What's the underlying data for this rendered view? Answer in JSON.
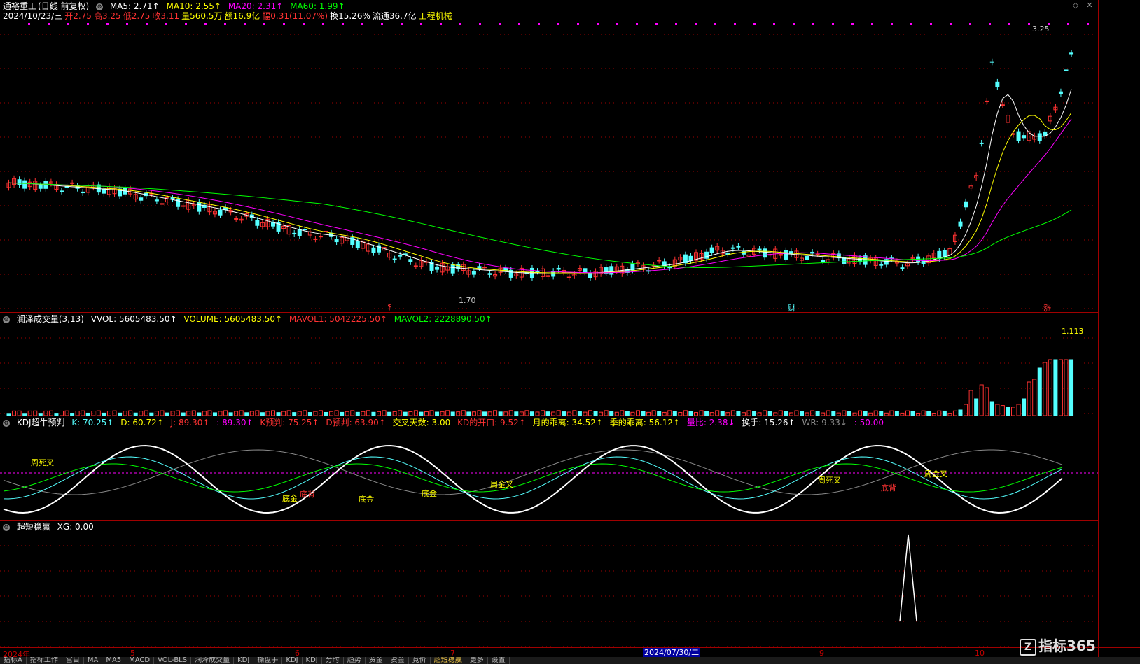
{
  "price_panel": {
    "stock_name": "通裕重工",
    "mode": "(日线 前复权)",
    "ma5": "MA5: 2.71↑",
    "ma10": "MA10: 2.55↑",
    "ma20": "MA20: 2.31↑",
    "ma60": "MA60: 1.99↑",
    "date": "2024/10/23/三",
    "open": "开2.75",
    "high": "高3.25",
    "low": "低2.75",
    "close": "收3.11",
    "volume": "量560.5万",
    "amount": "额16.9亿",
    "change": "幅0.31(11.07%)",
    "turnover": "换15.26%",
    "float": "流通36.7亿",
    "industry": "工程机械",
    "high_label": "3.25",
    "low_label": "1.70",
    "markers": [
      "$",
      "财",
      "涨"
    ]
  },
  "volume_panel": {
    "title": "润泽成交量(3,13)",
    "vvol": "VVOL: 5605483.50↑",
    "volume": "VOLUME: 5605483.50↑",
    "mavol1": "MAVOL1: 5042225.50↑",
    "mavol2": "MAVOL2: 2228890.50↑",
    "scale_label": "1.113"
  },
  "kdj_panel": {
    "title": "KDJ超牛预判",
    "k": "K: 70.25↑",
    "d": "D: 60.72↑",
    "j": "J: 89.30↑",
    "j2": ": 89.30↑",
    "k_pred": "K预判: 75.25↑",
    "d_pred": "D预判: 63.90↑",
    "cross_days": "交叉天数: 3.00",
    "kd_open": "KD的开口: 9.52↑",
    "month_dev": "月的乖离: 34.52↑",
    "season_dev": "季的乖离: 56.12↑",
    "vol_ratio": "量比: 2.38↓",
    "turnover": "换手: 15.26↑",
    "wr": "WR: 9.33↓",
    "extra": ": 50.00",
    "labels": [
      "周死叉",
      "底金",
      "底背",
      "底金",
      "底金",
      "周金叉",
      "周死叉",
      "底背",
      "周金叉"
    ]
  },
  "signal_panel": {
    "title": "超短稳赢",
    "xg": "XG: 0.00"
  },
  "x_axis": [
    "2024年",
    "5",
    "6",
    "7",
    "9",
    "10"
  ],
  "selected_date": "2024/07/30/二",
  "tabs": [
    "指标A",
    "指标工作",
    "宫目",
    "MA",
    "MA5",
    "MACD",
    "VOL-BLS",
    "润泽成交量",
    "KDJ",
    "操盘手",
    "KDJ",
    "KDJ",
    "分时",
    "趋势",
    "资金",
    "资金",
    "竞价",
    "超短稳赢",
    "更多",
    "设置"
  ],
  "active_tab_index": 17,
  "logo_text": "指标365",
  "colors": {
    "up": "#ff3232",
    "down": "#54ffff",
    "ma5": "#ffffff",
    "ma10": "#ffff00",
    "ma20": "#ff00ff",
    "ma60": "#00ff00",
    "grid": "#a00000"
  }
}
